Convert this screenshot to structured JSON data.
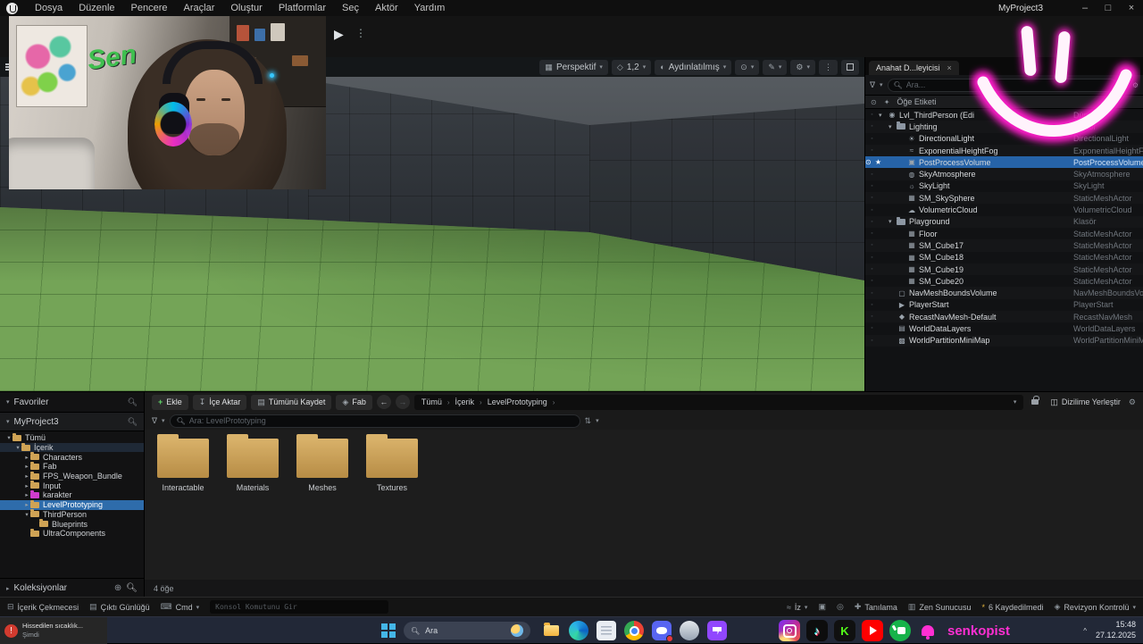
{
  "menubar": {
    "items": [
      "Dosya",
      "Düzenle",
      "Pencere",
      "Araçlar",
      "Oluştur",
      "Platformlar",
      "Seç",
      "Aktör",
      "Yardım"
    ],
    "project": "MyProject3"
  },
  "viewport": {
    "perspective_label": "Perspektif",
    "camera_speed": "1,2",
    "lit_label": "Aydınlatılmış"
  },
  "outliner": {
    "tab": "Anahat D...leyicisi",
    "search_placeholder": "Ara...",
    "header": "Öğe Etiketi",
    "rows": [
      {
        "label": "Lvl_ThirdPerson (Edi",
        "type": "Dünya",
        "indent": 0,
        "icon": "level",
        "arrow": "down"
      },
      {
        "label": "Lighting",
        "type": "Klasör",
        "indent": 1,
        "icon": "folder",
        "arrow": "down"
      },
      {
        "label": "DirectionalLight",
        "type": "DirectionalLight",
        "indent": 2,
        "icon": "sun",
        "arrow": ""
      },
      {
        "label": "ExponentialHeightFog",
        "type": "ExponentialHeightFog",
        "indent": 2,
        "icon": "fog",
        "arrow": ""
      },
      {
        "label": "PostProcessVolume",
        "type": "PostProcessVolume",
        "indent": 2,
        "icon": "postprocess",
        "arrow": "",
        "selected": true
      },
      {
        "label": "SkyAtmosphere",
        "type": "SkyAtmosphere",
        "indent": 2,
        "icon": "sky",
        "arrow": ""
      },
      {
        "label": "SkyLight",
        "type": "SkyLight",
        "indent": 2,
        "icon": "skylight",
        "arrow": ""
      },
      {
        "label": "SM_SkySphere",
        "type": "StaticMeshActor",
        "indent": 2,
        "icon": "mesh",
        "arrow": ""
      },
      {
        "label": "VolumetricCloud",
        "type": "VolumetricCloud",
        "indent": 2,
        "icon": "cloud",
        "arrow": ""
      },
      {
        "label": "Playground",
        "type": "Klasör",
        "indent": 1,
        "icon": "folder",
        "arrow": "down"
      },
      {
        "label": "Floor",
        "type": "StaticMeshActor",
        "indent": 2,
        "icon": "mesh",
        "arrow": ""
      },
      {
        "label": "SM_Cube17",
        "type": "StaticMeshActor",
        "indent": 2,
        "icon": "mesh",
        "arrow": ""
      },
      {
        "label": "SM_Cube18",
        "type": "StaticMeshActor",
        "indent": 2,
        "icon": "mesh",
        "arrow": ""
      },
      {
        "label": "SM_Cube19",
        "type": "StaticMeshActor",
        "indent": 2,
        "icon": "mesh",
        "arrow": ""
      },
      {
        "label": "SM_Cube20",
        "type": "StaticMeshActor",
        "indent": 2,
        "icon": "mesh",
        "arrow": ""
      },
      {
        "label": "NavMeshBoundsVolume",
        "type": "NavMeshBoundsVolume",
        "indent": 1,
        "icon": "volume",
        "arrow": ""
      },
      {
        "label": "PlayerStart",
        "type": "PlayerStart",
        "indent": 1,
        "icon": "player",
        "arrow": ""
      },
      {
        "label": "RecastNavMesh-Default",
        "type": "RecastNavMesh",
        "indent": 1,
        "icon": "nav",
        "arrow": ""
      },
      {
        "label": "WorldDataLayers",
        "type": "WorldDataLayers",
        "indent": 1,
        "icon": "layers",
        "arrow": ""
      },
      {
        "label": "WorldPartitionMiniMap",
        "type": "WorldPartitionMiniMap",
        "indent": 1,
        "icon": "map",
        "arrow": ""
      }
    ]
  },
  "content_browser": {
    "favorites_label": "Favoriler",
    "project_label": "MyProject3",
    "add_label": "Ekle",
    "import_label": "İçe Aktar",
    "save_all_label": "Tümünü Kaydet",
    "fab_label": "Fab",
    "breadcrumb": [
      "Tümü",
      "İçerik",
      "LevelPrototyping"
    ],
    "search_placeholder": "Ara: LevelPrototyping",
    "dock_label": "Dizilime Yerleştir",
    "collections_label": "Koleksiyonlar",
    "item_count": "4 öğe",
    "tree": [
      {
        "label": "Tümü",
        "indent": 0,
        "icon": "gold",
        "arrow": "down"
      },
      {
        "label": "İçerik",
        "indent": 1,
        "icon": "gold",
        "arrow": "down",
        "secondary": true
      },
      {
        "label": "Characters",
        "indent": 2,
        "icon": "gold",
        "arrow": "right"
      },
      {
        "label": "Fab",
        "indent": 2,
        "icon": "gold",
        "arrow": "right"
      },
      {
        "label": "FPS_Weapon_Bundle",
        "indent": 2,
        "icon": "gold",
        "arrow": "right"
      },
      {
        "label": "Input",
        "indent": 2,
        "icon": "gold",
        "arrow": "right"
      },
      {
        "label": "karakter",
        "indent": 2,
        "icon": "magenta",
        "arrow": "right"
      },
      {
        "label": "LevelPrototyping",
        "indent": 2,
        "icon": "gold",
        "arrow": "right",
        "selected": true
      },
      {
        "label": "ThirdPerson",
        "indent": 2,
        "icon": "gold",
        "arrow": "down"
      },
      {
        "label": "Blueprints",
        "indent": 3,
        "icon": "gold",
        "arrow": ""
      },
      {
        "label": "UltraComponents",
        "indent": 2,
        "icon": "gold",
        "arrow": ""
      }
    ],
    "folders": [
      "Interactable",
      "Materials",
      "Meshes",
      "Textures"
    ]
  },
  "statusbar": {
    "content_drawer": "İçerik Çekmecesi",
    "output_log": "Çıktı Günlüğü",
    "cmd": "Cmd",
    "console_placeholder": "Konsol Komutunu Gir",
    "trace": "İz",
    "diagnostics": "Tanılama",
    "zen_server": "Zen Sunucusu",
    "unsaved": "6 Kaydedilmedi",
    "revision_control": "Revizyon Kontrolü"
  },
  "taskbar": {
    "notification_title": "Hissedilen sıcaklık...",
    "notification_time": "Şimdi",
    "search_placeholder": "Ara",
    "apps": [
      "file-explorer",
      "edge",
      "notepad",
      "chrome",
      "discord",
      "steam",
      "twitch"
    ],
    "social": [
      "instagram",
      "tiktok",
      "kick",
      "youtube",
      "like",
      "bell"
    ],
    "username": "senkopist",
    "time": "15:48",
    "date": "27.12.2025"
  },
  "webcam": {
    "graffiti": "Sen"
  }
}
